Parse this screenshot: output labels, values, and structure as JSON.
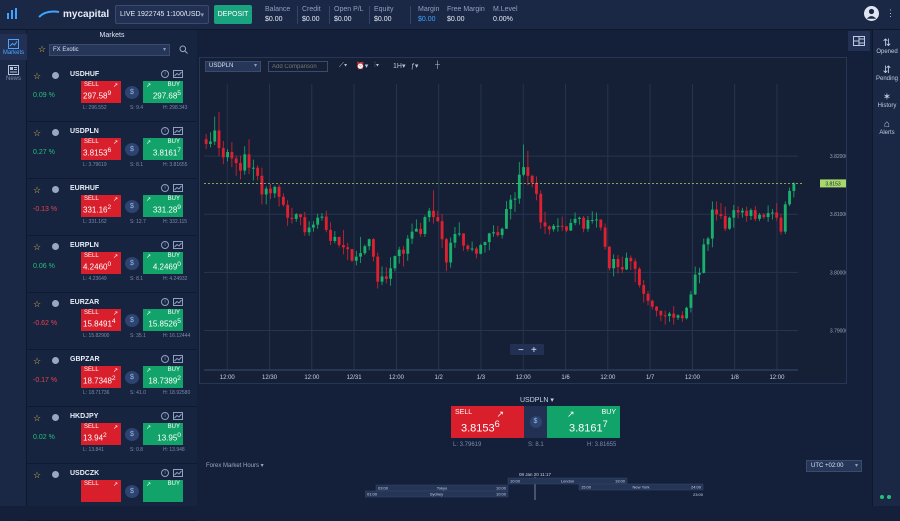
{
  "topbar": {
    "brand": "mycapital",
    "account": "LIVE 1922745 1:100/USD",
    "deposit": "DEPOSIT",
    "stats": [
      {
        "key": "Balance",
        "value": "$0.00",
        "blue": false
      },
      {
        "key": "Credit",
        "value": "$0.00",
        "blue": false
      },
      {
        "key": "Open P/L",
        "value": "$0.00",
        "blue": false
      },
      {
        "key": "Equity",
        "value": "$0.00",
        "blue": false
      },
      {
        "key": "Margin",
        "value": "$0.00",
        "blue": true
      },
      {
        "key": "Free Margin",
        "value": "$0.00",
        "blue": false
      },
      {
        "key": "M.Level",
        "value": "0.00%",
        "blue": false
      }
    ]
  },
  "leftnav": {
    "markets": "Markets",
    "news": "News"
  },
  "markets": {
    "title": "Markets",
    "category": "FX Exotic",
    "sell_label": "SELL",
    "buy_label": "BUY",
    "rows": [
      {
        "symbol": "USDHUF",
        "change": "0.09 %",
        "dir": "up",
        "sell": "297.58",
        "sell_pip": "9",
        "buy": "297.68",
        "buy_pip": "5",
        "low": "L: 296.552",
        "spread": "S: 9.4",
        "high": "H: 298.343"
      },
      {
        "symbol": "USDPLN",
        "change": "0.27 %",
        "dir": "up",
        "sell": "3.8153",
        "sell_pip": "6",
        "buy": "3.8161",
        "buy_pip": "7",
        "low": "L: 3.79619",
        "spread": "S: 8.1",
        "high": "H: 3.81655"
      },
      {
        "symbol": "EURHUF",
        "change": "-0.13 %",
        "dir": "dn",
        "sell": "331.16",
        "sell_pip": "2",
        "buy": "331.28",
        "buy_pip": "9",
        "low": "L: 331.162",
        "spread": "S: 12.7",
        "high": "H: 332.115"
      },
      {
        "symbol": "EURPLN",
        "change": "0.06 %",
        "dir": "up",
        "sell": "4.2460",
        "sell_pip": "0",
        "buy": "4.2469",
        "buy_pip": "0",
        "low": "L: 4.23649",
        "spread": "S: 8.1",
        "high": "H: 4.24932"
      },
      {
        "symbol": "EURZAR",
        "change": "-0.62 %",
        "dir": "dn",
        "sell": "15.8491",
        "sell_pip": "4",
        "buy": "15.8526",
        "buy_pip": "5",
        "low": "L: 15.82900",
        "spread": "S: 35.1",
        "high": "H: 16.12444"
      },
      {
        "symbol": "GBPZAR",
        "change": "-0.17 %",
        "dir": "dn",
        "sell": "18.7348",
        "sell_pip": "2",
        "buy": "18.7389",
        "buy_pip": "2",
        "low": "L: 18.71736",
        "spread": "S: 41.0",
        "high": "H: 18.92580"
      },
      {
        "symbol": "HKDJPY",
        "change": "0.02 %",
        "dir": "up",
        "sell": "13.94",
        "sell_pip": "2",
        "buy": "13.95",
        "buy_pip": "0",
        "low": "L: 13.841",
        "spread": "S: 0.8",
        "high": "H: 13.948"
      },
      {
        "symbol": "USDCZK",
        "change": "",
        "dir": "up",
        "sell": "",
        "sell_pip": "",
        "buy": "",
        "buy_pip": "",
        "low": "",
        "spread": "",
        "high": ""
      }
    ]
  },
  "chart_toolbar": {
    "symbol": "USDPLN",
    "compare_placeholder": "Add Comparison",
    "timeframe": "1H"
  },
  "chart_data": {
    "type": "candlestick",
    "x_tick_labels": [
      "12:00",
      "12/30",
      "12:00",
      "12/31",
      "12:00",
      "1/2",
      "1/3",
      "12:00",
      "1/6",
      "12:00",
      "1/7",
      "12:00",
      "1/8",
      "12:00"
    ],
    "y_tick_labels": [
      "3.82000",
      "3.81000",
      "3.80000",
      "3.79000"
    ],
    "y_ticks": [
      3.82,
      3.81,
      3.8,
      3.79
    ],
    "ylim": [
      3.7832,
      3.8324
    ],
    "current_price": 3.8153,
    "current_label": "3.8153",
    "grid": true,
    "ohlc": [
      [
        3.8229,
        3.8238,
        3.8212,
        3.8221
      ],
      [
        3.8221,
        3.8241,
        3.8215,
        3.8225
      ],
      [
        3.8225,
        3.8268,
        3.8219,
        3.8244
      ],
      [
        3.8244,
        3.8276,
        3.82,
        3.8214
      ],
      [
        3.8214,
        3.8226,
        3.8186,
        3.8198
      ],
      [
        3.8198,
        3.8212,
        3.8191,
        3.8207
      ],
      [
        3.8207,
        3.8224,
        3.8181,
        3.8196
      ],
      [
        3.8196,
        3.8201,
        3.8166,
        3.8188
      ],
      [
        3.8188,
        3.8201,
        3.816,
        3.8175
      ],
      [
        3.8175,
        3.8217,
        3.8168,
        3.8203
      ],
      [
        3.8203,
        3.8229,
        3.8169,
        3.818
      ],
      [
        3.818,
        3.8194,
        3.8158,
        3.818
      ],
      [
        3.818,
        3.8184,
        3.8158,
        3.8166
      ],
      [
        3.8166,
        3.818,
        3.8117,
        3.8134
      ],
      [
        3.8134,
        3.8148,
        3.8117,
        3.8144
      ],
      [
        3.8144,
        3.8152,
        3.8126,
        3.8136
      ],
      [
        3.8136,
        3.8149,
        3.8128,
        3.8147
      ],
      [
        3.8147,
        3.8151,
        3.8113,
        3.813
      ],
      [
        3.813,
        3.8136,
        3.8113,
        3.8116
      ],
      [
        3.8116,
        3.8124,
        3.808,
        3.8094
      ],
      [
        3.8094,
        3.8111,
        3.8084,
        3.8092
      ],
      [
        3.8092,
        3.8102,
        3.8087,
        3.81
      ],
      [
        3.81,
        3.8101,
        3.8081,
        3.8095
      ],
      [
        3.8095,
        3.8104,
        3.8063,
        3.8069
      ],
      [
        3.8069,
        3.8088,
        3.8063,
        3.8077
      ],
      [
        3.8077,
        3.8088,
        3.807,
        3.8082
      ],
      [
        3.8082,
        3.8101,
        3.8075,
        3.8094
      ],
      [
        3.8094,
        3.8102,
        3.8089,
        3.8096
      ],
      [
        3.8096,
        3.8106,
        3.8069,
        3.8073
      ],
      [
        3.8073,
        3.8086,
        3.8047,
        3.8054
      ],
      [
        3.8054,
        3.8071,
        3.805,
        3.8061
      ],
      [
        3.8061,
        3.8061,
        3.8043,
        3.8047
      ],
      [
        3.8047,
        3.8073,
        3.8031,
        3.8043
      ],
      [
        3.8043,
        3.8051,
        3.8021,
        3.804
      ],
      [
        3.804,
        3.804,
        3.8018,
        3.802
      ],
      [
        3.802,
        3.8037,
        3.8012,
        3.8027
      ],
      [
        3.8027,
        3.8061,
        3.8016,
        3.8033
      ],
      [
        3.8033,
        3.8048,
        3.803,
        3.8045
      ],
      [
        3.8045,
        3.8058,
        3.8038,
        3.8057
      ],
      [
        3.8057,
        3.8059,
        3.8019,
        3.8027
      ],
      [
        3.8027,
        3.8034,
        3.7972,
        3.7984
      ],
      [
        3.7984,
        3.801,
        3.7978,
        3.7993
      ],
      [
        3.7993,
        3.8009,
        3.7981,
        3.7989
      ],
      [
        3.7989,
        3.8026,
        3.7977,
        3.8007
      ],
      [
        3.8007,
        3.8029,
        3.8002,
        3.8028
      ],
      [
        3.8028,
        3.8044,
        3.8015,
        3.8039
      ],
      [
        3.8039,
        3.8045,
        3.801,
        3.8032
      ],
      [
        3.8032,
        3.8064,
        3.802,
        3.8058
      ],
      [
        3.8058,
        3.8084,
        3.8049,
        3.807
      ],
      [
        3.807,
        3.8091,
        3.807,
        3.8075
      ],
      [
        3.8075,
        3.8085,
        3.8061,
        3.8066
      ],
      [
        3.8066,
        3.8098,
        3.8061,
        3.8095
      ],
      [
        3.8095,
        3.8111,
        3.8087,
        3.8106
      ],
      [
        3.8106,
        3.8141,
        3.8084,
        3.8095
      ],
      [
        3.8095,
        3.8106,
        3.8087,
        3.8088
      ],
      [
        3.8088,
        3.81,
        3.8042,
        3.8057
      ],
      [
        3.8057,
        3.8059,
        3.8002,
        3.8017
      ],
      [
        3.8017,
        3.806,
        3.8008,
        3.8051
      ],
      [
        3.8051,
        3.8078,
        3.8042,
        3.8066
      ],
      [
        3.8066,
        3.8086,
        3.8062,
        3.8067
      ],
      [
        3.8067,
        3.8067,
        3.8037,
        3.8046
      ],
      [
        3.8046,
        3.8048,
        3.8036,
        3.804
      ],
      [
        3.804,
        3.8053,
        3.8036,
        3.8041
      ],
      [
        3.8041,
        3.8044,
        3.8024,
        3.8032
      ],
      [
        3.8032,
        3.8049,
        3.8031,
        3.8047
      ],
      [
        3.8047,
        3.8053,
        3.8034,
        3.8052
      ],
      [
        3.8052,
        3.8068,
        3.8038,
        3.8067
      ],
      [
        3.8067,
        3.8081,
        3.8061,
        3.8069
      ],
      [
        3.8069,
        3.808,
        3.8061,
        3.8064
      ],
      [
        3.8064,
        3.8077,
        3.8058,
        3.8075
      ],
      [
        3.8075,
        3.8123,
        3.8075,
        3.8109
      ],
      [
        3.8109,
        3.8133,
        3.8091,
        3.8125
      ],
      [
        3.8125,
        3.8138,
        3.8104,
        3.8127
      ],
      [
        3.8127,
        3.819,
        3.8118,
        3.8168
      ],
      [
        3.8168,
        3.822,
        3.8165,
        3.8181
      ],
      [
        3.8181,
        3.8209,
        3.815,
        3.8166
      ],
      [
        3.8166,
        3.8168,
        3.8146,
        3.8154
      ],
      [
        3.8154,
        3.8165,
        3.8124,
        3.8135
      ],
      [
        3.8135,
        3.8141,
        3.8075,
        3.8086
      ],
      [
        3.8086,
        3.8104,
        3.8066,
        3.8079
      ],
      [
        3.8079,
        3.8081,
        3.8065,
        3.8074
      ],
      [
        3.8074,
        3.8083,
        3.807,
        3.808
      ],
      [
        3.808,
        3.8093,
        3.807,
        3.808
      ],
      [
        3.808,
        3.8096,
        3.8071,
        3.8079
      ],
      [
        3.8079,
        3.808,
        3.8069,
        3.8072
      ],
      [
        3.8072,
        3.8092,
        3.8071,
        3.8085
      ],
      [
        3.8085,
        3.8103,
        3.8081,
        3.8092
      ],
      [
        3.8092,
        3.8096,
        3.8082,
        3.8094
      ],
      [
        3.8094,
        3.8097,
        3.8069,
        3.8075
      ],
      [
        3.8075,
        3.8097,
        3.807,
        3.809
      ],
      [
        3.809,
        3.8105,
        3.8084,
        3.809
      ],
      [
        3.809,
        3.8103,
        3.8077,
        3.8091
      ],
      [
        3.8091,
        3.8091,
        3.8072,
        3.8077
      ],
      [
        3.8077,
        3.8084,
        3.8039,
        3.8044
      ],
      [
        3.8044,
        3.8045,
        3.8003,
        3.8007
      ],
      [
        3.8007,
        3.8031,
        3.7993,
        3.8023
      ],
      [
        3.8023,
        3.803,
        3.7998,
        3.8009
      ],
      [
        3.8009,
        3.8027,
        3.7999,
        3.8005
      ],
      [
        3.8005,
        3.8034,
        3.8004,
        3.8025
      ],
      [
        3.8025,
        3.8029,
        3.8004,
        3.8019
      ],
      [
        3.8019,
        3.8024,
        3.7983,
        3.8006
      ],
      [
        3.8006,
        3.8009,
        3.7974,
        3.7978
      ],
      [
        3.7978,
        3.7987,
        3.7948,
        3.7963
      ],
      [
        3.7963,
        3.7968,
        3.7943,
        3.7951
      ],
      [
        3.7951,
        3.7953,
        3.7936,
        3.7941
      ],
      [
        3.7941,
        3.7942,
        3.7924,
        3.7934
      ],
      [
        3.7934,
        3.7934,
        3.7916,
        3.7926
      ],
      [
        3.7926,
        3.7934,
        3.791,
        3.7925
      ],
      [
        3.7925,
        3.7932,
        3.7915,
        3.7929
      ],
      [
        3.7929,
        3.7942,
        3.791,
        3.7922
      ],
      [
        3.7922,
        3.7928,
        3.7918,
        3.7926
      ],
      [
        3.7926,
        3.7933,
        3.7915,
        3.7921
      ],
      [
        3.7921,
        3.7941,
        3.7919,
        3.7939
      ],
      [
        3.7939,
        3.7968,
        3.7931,
        3.7962
      ],
      [
        3.7962,
        3.801,
        3.7961,
        3.7996
      ],
      [
        3.7996,
        3.8008,
        3.7981,
        3.7999
      ],
      [
        3.7999,
        3.8058,
        3.7998,
        3.8048
      ],
      [
        3.8048,
        3.8061,
        3.8037,
        3.8058
      ],
      [
        3.8058,
        3.8122,
        3.8043,
        3.8108
      ],
      [
        3.8108,
        3.8122,
        3.8089,
        3.81
      ],
      [
        3.81,
        3.8119,
        3.8092,
        3.8097
      ],
      [
        3.8097,
        3.8113,
        3.8071,
        3.8075
      ],
      [
        3.8075,
        3.8096,
        3.8073,
        3.8094
      ],
      [
        3.8094,
        3.8116,
        3.8077,
        3.8107
      ],
      [
        3.8107,
        3.8114,
        3.8093,
        3.8103
      ],
      [
        3.8103,
        3.8111,
        3.8094,
        3.8106
      ],
      [
        3.8106,
        3.8113,
        3.8087,
        3.8097
      ],
      [
        3.8097,
        3.811,
        3.809,
        3.8107
      ],
      [
        3.8107,
        3.8114,
        3.8088,
        3.8092
      ],
      [
        3.8092,
        3.8102,
        3.8088,
        3.8099
      ],
      [
        3.8099,
        3.8102,
        3.8092,
        3.8095
      ],
      [
        3.8095,
        3.8115,
        3.8087,
        3.8102
      ],
      [
        3.8102,
        3.8109,
        3.8091,
        3.8103
      ],
      [
        3.8103,
        3.8119,
        3.8089,
        3.8094
      ],
      [
        3.8094,
        3.8101,
        3.8065,
        3.807
      ],
      [
        3.807,
        3.8122,
        3.8066,
        3.8117
      ],
      [
        3.8117,
        3.8146,
        3.8114,
        3.814
      ],
      [
        3.814,
        3.8155,
        3.8129,
        3.8153
      ]
    ]
  },
  "ticket": {
    "symbol": "USDPLN",
    "sell_label": "SELL",
    "buy_label": "BUY",
    "sell": "3.8153",
    "sell_pip": "6",
    "buy": "3.8161",
    "buy_pip": "7",
    "low": "L: 3.79619",
    "spread": "S: 8.1",
    "high": "H: 3.81655"
  },
  "bottom": {
    "forex_hours": "Forex Market Hours",
    "utc": "UTC +02:00",
    "now": "08 Jan 20 11:17",
    "sessions": [
      {
        "name": "Sydney",
        "start": "01:00",
        "end": "10:00"
      },
      {
        "name": "Tokyo",
        "start": "03:00",
        "end": "10:00"
      },
      {
        "name": "London",
        "start": "10:00",
        "end": "19:00"
      },
      {
        "name": "New York",
        "start": "15:00",
        "end": "24:00"
      }
    ],
    "sessions_extra_end": "23:00"
  },
  "rightnav": [
    {
      "label": "Opened",
      "icon": "⇅"
    },
    {
      "label": "Pending",
      "icon": "⇵"
    },
    {
      "label": "History",
      "icon": "✶"
    },
    {
      "label": "Alerts",
      "icon": "⌂"
    }
  ],
  "colors": {
    "bull": "#18b06c",
    "bear": "#e0202f",
    "accent": "#3fa4ff",
    "grid": "#26344f",
    "price_line": "#a7d86b"
  }
}
